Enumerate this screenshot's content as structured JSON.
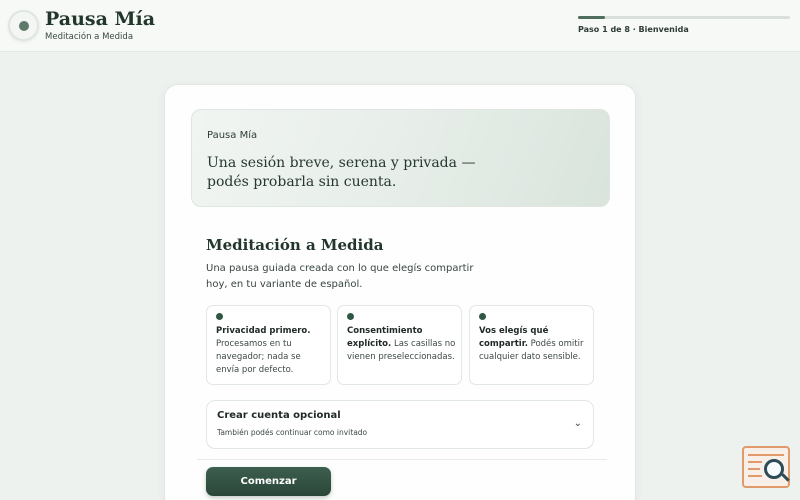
{
  "header": {
    "title": "Pausa Mía",
    "subtitle": "Meditación a Medida",
    "progress": {
      "fraction": 0.125,
      "label": "Paso 1 de 8 · Bienvenida"
    }
  },
  "hero": {
    "label": "Pausa Mía",
    "text": "Una sesión breve, serena y privada — podés probarla sin cuenta."
  },
  "intro": {
    "title": "Meditación a Medida",
    "description": "Una pausa guiada creada con lo que elegís compartir hoy, en tu variante de español."
  },
  "features": [
    {
      "title": "Privacidad primero.",
      "text": "Procesamos en tu navegador; nada se envía por defecto."
    },
    {
      "title": "Consentimiento explícito.",
      "text": "Las casillas no vienen preseleccionadas."
    },
    {
      "title": "Vos elegís qué compartir.",
      "text": "Podés omitir cualquier dato sensible."
    }
  ],
  "account": {
    "title": "Crear cuenta opcional",
    "subtitle": "También podés continuar como invitado",
    "icon": "chevron-down-icon"
  },
  "actions": {
    "start_label": "Comenzar"
  },
  "colors": {
    "accent": "#2f4c3e",
    "progress": "#4f6e5c",
    "help_border": "#e09a6b"
  }
}
